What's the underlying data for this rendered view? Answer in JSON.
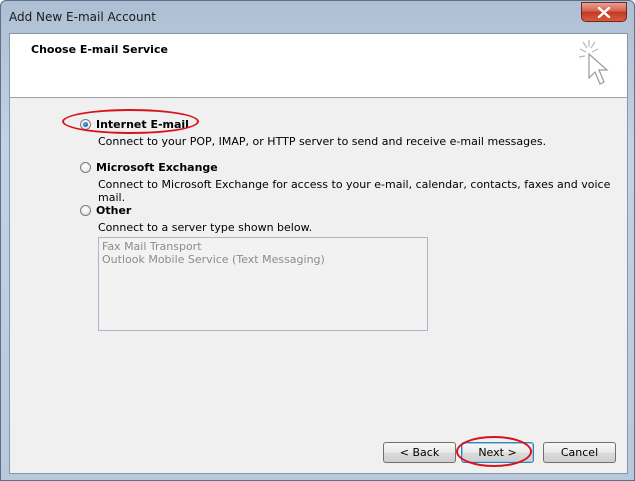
{
  "window": {
    "title": "Add New E-mail Account",
    "close_icon": "close-icon"
  },
  "header": {
    "title": "Choose E-mail Service",
    "icon": "wizard-cursor-icon"
  },
  "options": [
    {
      "label": "Internet E-mail",
      "description": "Connect to your POP, IMAP, or HTTP server to send and receive e-mail messages.",
      "selected": true
    },
    {
      "label": "Microsoft Exchange",
      "description": "Connect to Microsoft Exchange for access to your e-mail, calendar, contacts, faxes and voice mail.",
      "selected": false
    },
    {
      "label": "Other",
      "description": "Connect to a server type shown below.",
      "selected": false
    }
  ],
  "server_types": [
    "Fax Mail Transport",
    "Outlook Mobile Service (Text Messaging)"
  ],
  "buttons": {
    "back": "< Back",
    "next": "Next >",
    "cancel": "Cancel"
  },
  "colors": {
    "annotation": "#d8121b",
    "selected_radio": "#1b5fb3"
  }
}
